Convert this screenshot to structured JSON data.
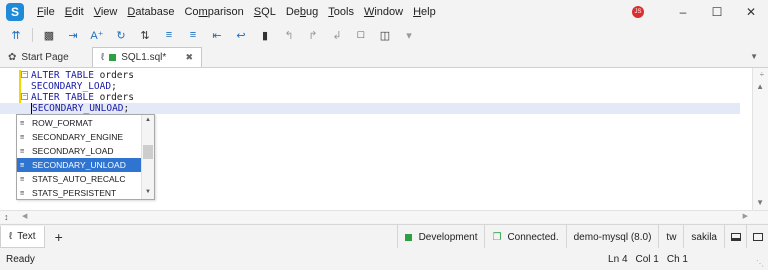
{
  "menu": {
    "items": [
      {
        "pre": "",
        "u": "F",
        "post": "ile"
      },
      {
        "pre": "",
        "u": "E",
        "post": "dit"
      },
      {
        "pre": "",
        "u": "V",
        "post": "iew"
      },
      {
        "pre": "",
        "u": "D",
        "post": "atabase"
      },
      {
        "pre": "Co",
        "u": "m",
        "post": "parison"
      },
      {
        "pre": "",
        "u": "S",
        "post": "QL"
      },
      {
        "pre": "De",
        "u": "b",
        "post": "ug"
      },
      {
        "pre": "",
        "u": "T",
        "post": "ools"
      },
      {
        "pre": "",
        "u": "W",
        "post": "indow"
      },
      {
        "pre": "",
        "u": "H",
        "post": "elp"
      }
    ],
    "user_initials": "JS"
  },
  "tabs": {
    "start": "Start Page",
    "active": "SQL1.sql*"
  },
  "editor": {
    "lines": [
      {
        "kw": "ALTER TABLE",
        "rest": " orders"
      },
      {
        "kw": "SECONDARY_LOAD",
        "rest": ";"
      },
      {
        "kw": "ALTER TABLE",
        "rest": " orders"
      },
      {
        "kw": "SECONDARY_UNLOAD",
        "rest": ";"
      }
    ]
  },
  "autocomplete": {
    "items": [
      "ROW_FORMAT",
      "SECONDARY_ENGINE",
      "SECONDARY_LOAD",
      "SECONDARY_UNLOAD",
      "STATS_AUTO_RECALC",
      "STATS_PERSISTENT"
    ],
    "selected_index": 3
  },
  "panel": {
    "text_tab": "Text",
    "environment": "Development",
    "connection_status": "Connected.",
    "server": "demo-mysql (8.0)",
    "user": "tw",
    "database": "sakila"
  },
  "status": {
    "ready": "Ready",
    "ln": "Ln 4",
    "col": "Col 1",
    "ch": "Ch 1"
  },
  "colors": {
    "keyword": "#1a1aa6",
    "selection": "#2f74d0",
    "connected": "#2ea043"
  }
}
